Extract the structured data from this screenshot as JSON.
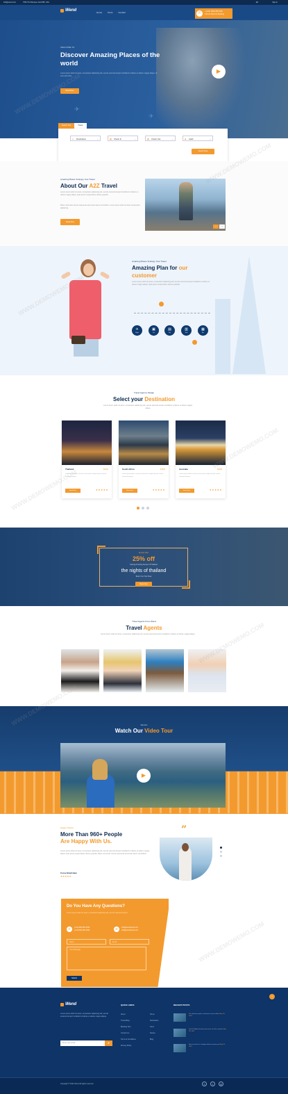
{
  "topbar": {
    "email": "info@wend.com",
    "address": "7050 The Baroque Gold 885, USA",
    "lang": "EN",
    "login": "Sign In"
  },
  "header": {
    "logo": "Wend",
    "menu": [
      "Home",
      "Tours",
      "Contact"
    ],
    "call_line1": "+ (123) 1800-453-1546",
    "call_line2": "Call Us Now For Booking"
  },
  "hero": {
    "subtitle": "WELCOME TO",
    "title": "Discover Amazing Places of the world",
    "desc": "Lorem ipsum dolor sit amet, consectetur adipiscing elit, sed do eiusmod tempor incididunt ut labore et dolore magna aliqua. Ut enim ad minim.",
    "button": "Read More"
  },
  "search": {
    "tab1": "Search Tour",
    "tab2": "Hotels",
    "fields": [
      "Destination",
      "Check In",
      "Check Out",
      "Adult"
    ],
    "button": "Search Now"
  },
  "about": {
    "subtitle": "Amazing Places To Enjoy Your Travel",
    "title": "About Our",
    "title_accent": "A2Z",
    "title_end": "Travel",
    "p1": "Lorem ipsum dolor sit amet, consectetur adipiscing elit, sed do eiusmod tempor incididunt ut labore et dolore magna aliqua. Quis ipsum suspendisse ultrices gravida.",
    "p2": "Risus commodo viverra maecenas accumsan lacus vel facilisis. Lorem ipsum dolor sit amet consectetur adipiscing.",
    "button": "Read More"
  },
  "plan": {
    "subtitle": "Amazing Places To Enjoy Your Travel",
    "title": "Amazing Plan for",
    "title_accent": "our",
    "title_line2": "customer",
    "desc": "Lorem ipsum dolor sit amet, consectetur adipiscing elit, sed do eiusmod tempor incididunt ut labore et dolore magna aliqua. Quis ipsum suspendisse ultrices gravida.",
    "icons": [
      {
        "label": "Flight",
        "icon": "plane"
      },
      {
        "label": "Car",
        "icon": "car"
      },
      {
        "label": "Taxi",
        "icon": "taxi"
      },
      {
        "label": "Train",
        "icon": "train"
      },
      {
        "label": "Bus",
        "icon": "bus"
      }
    ]
  },
  "destination": {
    "subtitle": "Travel Agency Pasaje",
    "title": "Select your",
    "title_accent": "Destination",
    "desc": "Lorem ipsum dolor sit amet, consectetur adipiscing elit, sed do eiusmod tempor incididunt ut labore et dolore magna aliqua.",
    "cards": [
      {
        "name": "Thailand",
        "price": "$5000",
        "text": "Lorem ipsum dolor sit amet consectetur adipiscing elit sed do eiusmod tempor.",
        "button": "Book Now",
        "stars": "★★★★★"
      },
      {
        "name": "South Africa",
        "price": "$4500",
        "text": "Lorem ipsum dolor sit amet consectetur adipiscing elit sed do eiusmod tempor.",
        "button": "Book Now",
        "stars": "★★★★★"
      },
      {
        "name": "Australia",
        "price": "$6000",
        "text": "Lorem ipsum dolor sit amet consectetur adipiscing elit sed do eiusmod tempor.",
        "button": "Book Now",
        "stars": "★★★★★"
      }
    ]
  },
  "offer": {
    "line1": "Special Offer",
    "percent": "25% off",
    "line2": "Seeing Amazing Sunset of Thailand",
    "line3": "the nights of thailand",
    "line4": "Book Your Tour Now",
    "button": "Book Now"
  },
  "agents": {
    "subtitle": "Travel Agents From Wend",
    "title": "Travel",
    "title_accent": "Agents",
    "desc": "Lorem ipsum dolor sit amet, consectetur adipiscing elit, sed do eiusmod tempor incididunt ut labore et dolore magna aliqua."
  },
  "video": {
    "subtitle": "Wend's",
    "title": "Watch Our",
    "title_accent": "Video Tour"
  },
  "testimonial": {
    "subtitle": "Happy Clients",
    "title_line1": "More Than 960+ People",
    "title_line2": "Are Happy With Us.",
    "text": "Lorem ipsum dolor sit amet, consectetur adipiscing elit, sed do eiusmod tempor incididunt ut labore et dolore magna aliqua. Quis ipsum suspendisse ultrices gravida. Risus commodo viverra maecenas accumsan lacus vel facilisis.",
    "name": "Corey Bradshaw",
    "stars": "★★★★★"
  },
  "contact": {
    "title": "Do You Have Any Questions?",
    "desc": "Lorem ipsum dolor sit amet, consectetur adipiscing elit, sed do eiusmod tempor.",
    "phone1": "(+12) 800-453-1546",
    "phone2": "(+12) 800-453-1546",
    "email1": "info@wendtravel.com",
    "email2": "info@wendtravel.com",
    "name_ph": "Name",
    "email_ph": "Email",
    "msg_ph": "Your Message",
    "button": "Submit"
  },
  "footer": {
    "logo": "Wend",
    "about": "Lorem ipsum dolor sit amet, consectetur adipiscing elit, sed do eiusmod tempor incididunt ut labore et dolore magna aliqua.",
    "email_ph": "Enter your email",
    "quick_title": "QUICK LINKS",
    "links1": [
      "About",
      "Travel Blog",
      "Booking Tour",
      "Contact Us",
      "Terms & Conditions",
      "Privacy Policy"
    ],
    "links2": [
      "Home",
      "Destination",
      "Tours",
      "Stories",
      "Blog"
    ],
    "recent_title": "RECENT POSTS",
    "posts": [
      {
        "t": "The ultimate guide to adventure travel in Asia",
        "d": "May 25, 2021"
      },
      {
        "t": "Top 10 hidden beaches you must visit this summer",
        "d": "May 25, 2021"
      },
      {
        "t": "How to travel on a budget without missing out",
        "d": "May 25, 2021"
      }
    ],
    "copyright": "Copyright © 2021 Wend All rights reserved."
  },
  "colors": {
    "navy": "#0e2a4f",
    "blue": "#1a4a86",
    "accent": "#f39a2e"
  },
  "watermark": "WWW.DEMOWEMO.COM"
}
